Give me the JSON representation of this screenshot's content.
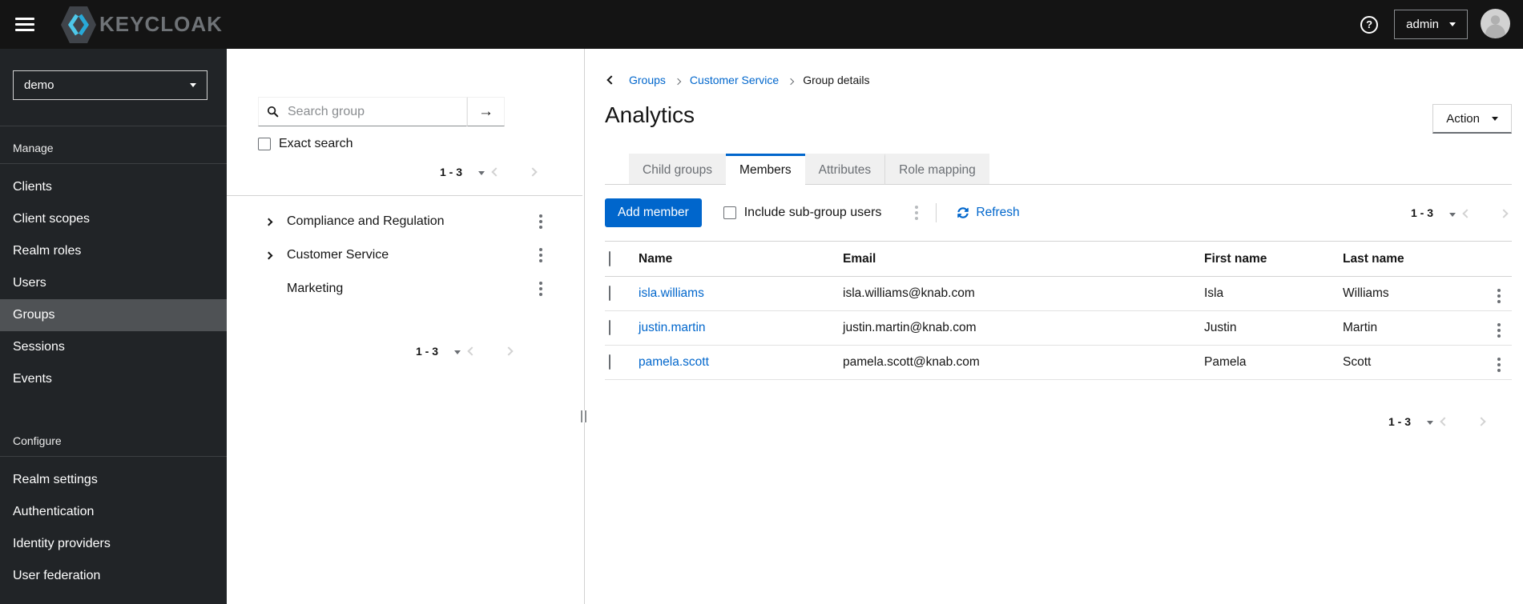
{
  "colors": {
    "accent": "#0066cc",
    "link": "#0066cc",
    "masthead_bg": "#141414",
    "sidebar_bg": "#212427",
    "sidebar_selected_bg": "#4f5255"
  },
  "icons": {
    "question_glyph": "?",
    "arrow_right_glyph": "→"
  },
  "masthead": {
    "brand_text": "KEYCLOAK",
    "user_label": "admin"
  },
  "sidebar": {
    "realm_selector_value": "demo",
    "selected_item": "Groups",
    "sections": [
      {
        "title": "Manage",
        "items": [
          "Clients",
          "Client scopes",
          "Realm roles",
          "Users",
          "Groups",
          "Sessions",
          "Events"
        ]
      },
      {
        "title": "Configure",
        "items": [
          "Realm settings",
          "Authentication",
          "Identity providers",
          "User federation"
        ]
      }
    ]
  },
  "groups_panel": {
    "search_placeholder": "Search group",
    "exact_search_label": "Exact search",
    "top_pagination_range": "1 - 3",
    "tree_items": [
      {
        "label": "Compliance and Regulation",
        "expandable": true
      },
      {
        "label": "Customer Service",
        "expandable": true
      },
      {
        "label": "Marketing",
        "expandable": false
      }
    ],
    "bottom_pagination_range": "1 - 3"
  },
  "main": {
    "breadcrumb": {
      "links": [
        "Groups",
        "Customer Service"
      ],
      "current": "Group details"
    },
    "title": "Analytics",
    "action_label": "Action",
    "tabs": [
      "Child groups",
      "Members",
      "Attributes",
      "Role mapping"
    ],
    "active_tab": "Members",
    "toolbar": {
      "add_member_label": "Add member",
      "include_subgroup_label": "Include sub-group users",
      "refresh_label": "Refresh",
      "pagination_range": "1 - 3"
    },
    "table": {
      "headers": [
        "Name",
        "Email",
        "First name",
        "Last name"
      ],
      "rows": [
        {
          "name": "isla.williams",
          "email": "isla.williams@knab.com",
          "first_name": "Isla",
          "last_name": "Williams"
        },
        {
          "name": "justin.martin",
          "email": "justin.martin@knab.com",
          "first_name": "Justin",
          "last_name": "Martin"
        },
        {
          "name": "pamela.scott",
          "email": "pamela.scott@knab.com",
          "first_name": "Pamela",
          "last_name": "Scott"
        }
      ]
    },
    "bottom_pagination_range": "1 - 3"
  }
}
